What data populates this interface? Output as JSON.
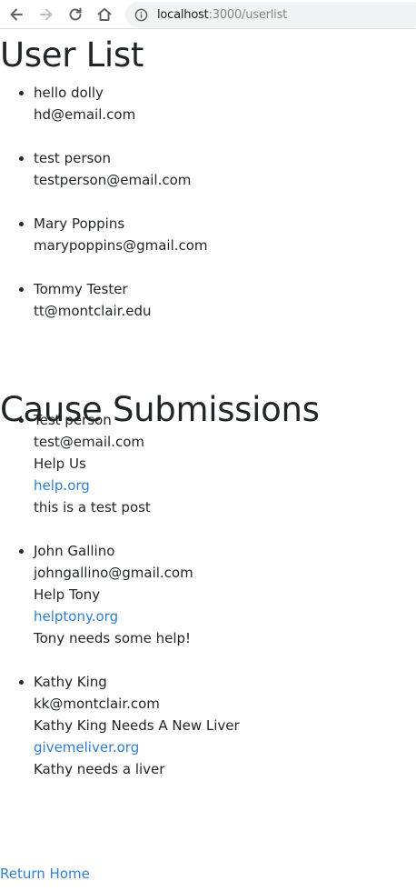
{
  "browser": {
    "url_host": "localhost",
    "url_path": ":3000/userlist"
  },
  "users_section": {
    "title": "User List",
    "users": [
      {
        "name": "hello dolly",
        "email": "hd@email.com"
      },
      {
        "name": "test person",
        "email": "testperson@email.com"
      },
      {
        "name": "Mary Poppins",
        "email": "marypoppins@gmail.com"
      },
      {
        "name": "Tommy Tester",
        "email": "tt@montclair.edu"
      }
    ]
  },
  "causes_section": {
    "title": "Cause Submissions",
    "causes": [
      {
        "name": "Test person",
        "email": "test@email.com",
        "cause_title": "Help Us",
        "link": "help.org",
        "description": "this is a test post"
      },
      {
        "name": "John Gallino",
        "email": "johngallino@gmail.com",
        "cause_title": "Help Tony",
        "link": "helptony.org",
        "description": "Tony needs some help!"
      },
      {
        "name": "Kathy King",
        "email": "kk@montclair.com",
        "cause_title": "Kathy King Needs A New Liver",
        "link": "givemeliver.org",
        "description": "Kathy needs a liver"
      }
    ]
  },
  "footer": {
    "return_home_label": "Return Home"
  }
}
